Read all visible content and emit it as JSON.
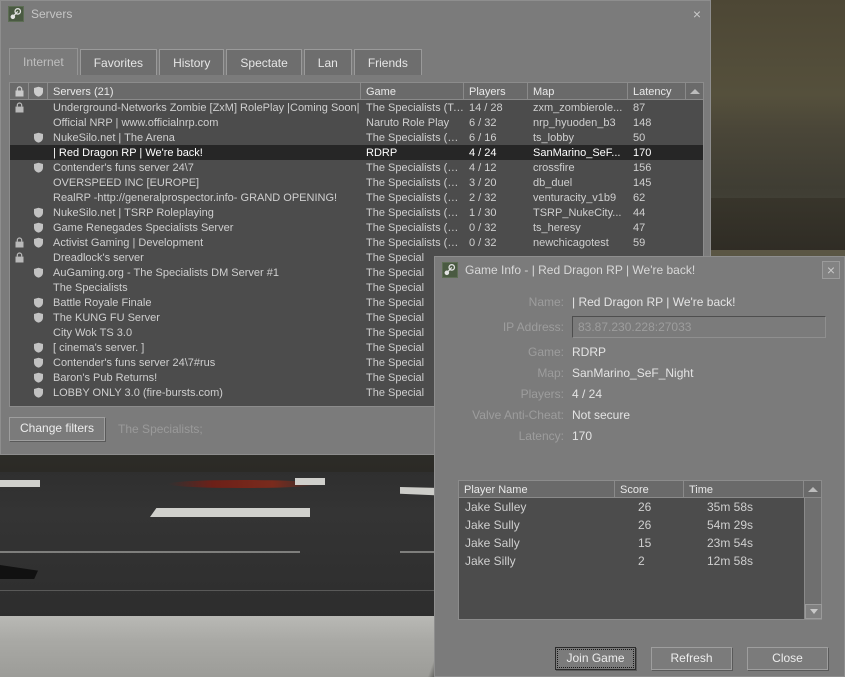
{
  "servers_window": {
    "title": "Servers",
    "icon": "steam-icon",
    "close_label": "×",
    "tabs": [
      {
        "label": "Internet",
        "active": true
      },
      {
        "label": "Favorites",
        "active": false
      },
      {
        "label": "History",
        "active": false
      },
      {
        "label": "Spectate",
        "active": false
      },
      {
        "label": "Lan",
        "active": false
      },
      {
        "label": "Friends",
        "active": false
      }
    ],
    "columns": {
      "lock": "lock-icon",
      "vac": "shield-icon",
      "name": "Servers (21)",
      "game": "Game",
      "players": "Players",
      "map": "Map",
      "latency": "Latency"
    },
    "rows": [
      {
        "lock": true,
        "vac": false,
        "name": "Underground-Networks Zombie [ZxM] RolePlay |Coming Soon|",
        "game": "The Specialists (Tea...",
        "players": "14 / 28",
        "map": "zxm_zombierole...",
        "latency": "87",
        "selected": false
      },
      {
        "lock": false,
        "vac": false,
        "name": "Official NRP | www.officialnrp.com",
        "game": "Naruto Role Play",
        "players": "6 / 32",
        "map": "nrp_hyuoden_b3",
        "latency": "148",
        "selected": false
      },
      {
        "lock": false,
        "vac": true,
        "name": "NukeSilo.net | The Arena",
        "game": "The Specialists (DM)",
        "players": "6 / 16",
        "map": "ts_lobby",
        "latency": "50",
        "selected": false
      },
      {
        "lock": false,
        "vac": false,
        "name": "| Red Dragon RP | We're back!",
        "game": "RDRP",
        "players": "4 / 24",
        "map": "SanMarino_SeF...",
        "latency": "170",
        "selected": true
      },
      {
        "lock": false,
        "vac": true,
        "name": "Contender's funs server 24\\7",
        "game": "The Specialists (DM)",
        "players": "4 / 12",
        "map": "crossfire",
        "latency": "156",
        "selected": false
      },
      {
        "lock": false,
        "vac": false,
        "name": "OVERSPEED INC [EUROPE]",
        "game": "The Specialists (DM)",
        "players": "3 / 20",
        "map": "db_duel",
        "latency": "145",
        "selected": false
      },
      {
        "lock": false,
        "vac": false,
        "name": "RealRP -http://generalprospector.info- GRAND OPENING!",
        "game": "The Specialists (DM)",
        "players": "2 / 32",
        "map": "venturacity_v1b9",
        "latency": "62",
        "selected": false
      },
      {
        "lock": false,
        "vac": true,
        "name": "NukeSilo.net | TSRP Roleplaying",
        "game": "The Specialists (DM)",
        "players": "1 / 30",
        "map": "TSRP_NukeCity...",
        "latency": "44",
        "selected": false
      },
      {
        "lock": false,
        "vac": true,
        "name": "Game Renegades Specialists Server",
        "game": "The Specialists (DM)",
        "players": "0 / 32",
        "map": "ts_heresy",
        "latency": "47",
        "selected": false
      },
      {
        "lock": true,
        "vac": true,
        "name": "Activist Gaming | Development",
        "game": "The Specialists (DM)",
        "players": "0 / 32",
        "map": "newchicagotest",
        "latency": "59",
        "selected": false
      },
      {
        "lock": true,
        "vac": false,
        "name": "Dreadlock's server",
        "game": "The Special",
        "players": "",
        "map": "",
        "latency": "",
        "selected": false
      },
      {
        "lock": false,
        "vac": true,
        "name": "AuGaming.org - The Specialists DM Server #1",
        "game": "The Special",
        "players": "",
        "map": "",
        "latency": "",
        "selected": false
      },
      {
        "lock": false,
        "vac": false,
        "name": "The Specialists",
        "game": "The Special",
        "players": "",
        "map": "",
        "latency": "",
        "selected": false
      },
      {
        "lock": false,
        "vac": true,
        "name": "Battle Royale Finale",
        "game": "The Special",
        "players": "",
        "map": "",
        "latency": "",
        "selected": false
      },
      {
        "lock": false,
        "vac": true,
        "name": "The KUNG FU Server",
        "game": "The Special",
        "players": "",
        "map": "",
        "latency": "",
        "selected": false
      },
      {
        "lock": false,
        "vac": false,
        "name": "City Wok TS 3.0",
        "game": "The Special",
        "players": "",
        "map": "",
        "latency": "",
        "selected": false
      },
      {
        "lock": false,
        "vac": true,
        "name": "[ cinema's server. ]",
        "game": "The Special",
        "players": "",
        "map": "",
        "latency": "",
        "selected": false
      },
      {
        "lock": false,
        "vac": true,
        "name": "Contender's funs server 24\\7#rus",
        "game": "The Special",
        "players": "",
        "map": "",
        "latency": "",
        "selected": false
      },
      {
        "lock": false,
        "vac": true,
        "name": "Baron's Pub Returns!",
        "game": "The Special",
        "players": "",
        "map": "",
        "latency": "",
        "selected": false
      },
      {
        "lock": false,
        "vac": true,
        "name": "LOBBY ONLY 3.0 (fire-bursts.com)",
        "game": "The Special",
        "players": "",
        "map": "",
        "latency": "",
        "selected": false
      }
    ],
    "filter": {
      "button_label": "Change filters",
      "summary": "The Specialists;"
    }
  },
  "game_info": {
    "title": "Game Info - | Red Dragon RP | We're back!",
    "icon": "steam-icon",
    "close_label": "×",
    "fields": {
      "name_label": "Name:",
      "name_value": "| Red Dragon RP | We're back!",
      "ip_label": "IP Address:",
      "ip_value": "83.87.230.228:27033",
      "game_label": "Game:",
      "game_value": "RDRP",
      "map_label": "Map:",
      "map_value": "SanMarino_SeF_Night",
      "players_label": "Players:",
      "players_value": "4 / 24",
      "vac_label": "Valve Anti-Cheat:",
      "vac_value": "Not secure",
      "latency_label": "Latency:",
      "latency_value": "170"
    },
    "player_columns": {
      "name": "Player Name",
      "score": "Score",
      "time": "Time"
    },
    "players": [
      {
        "name": "Jake Sulley",
        "score": "26",
        "time": "35m 58s"
      },
      {
        "name": "Jake Sully",
        "score": "26",
        "time": "54m 29s"
      },
      {
        "name": "Jake Sally",
        "score": "15",
        "time": "23m 54s"
      },
      {
        "name": "Jake Silly",
        "score": "2",
        "time": "12m 58s"
      }
    ],
    "buttons": {
      "join": "Join Game",
      "refresh": "Refresh",
      "close": "Close"
    }
  },
  "colors": {
    "panel": "#7b7b7b",
    "list_bg": "#4c4c4c",
    "selected_row": "#262626",
    "header": "#6a6a6a",
    "text": "#d8d8d8",
    "label": "#9d9d9d"
  }
}
